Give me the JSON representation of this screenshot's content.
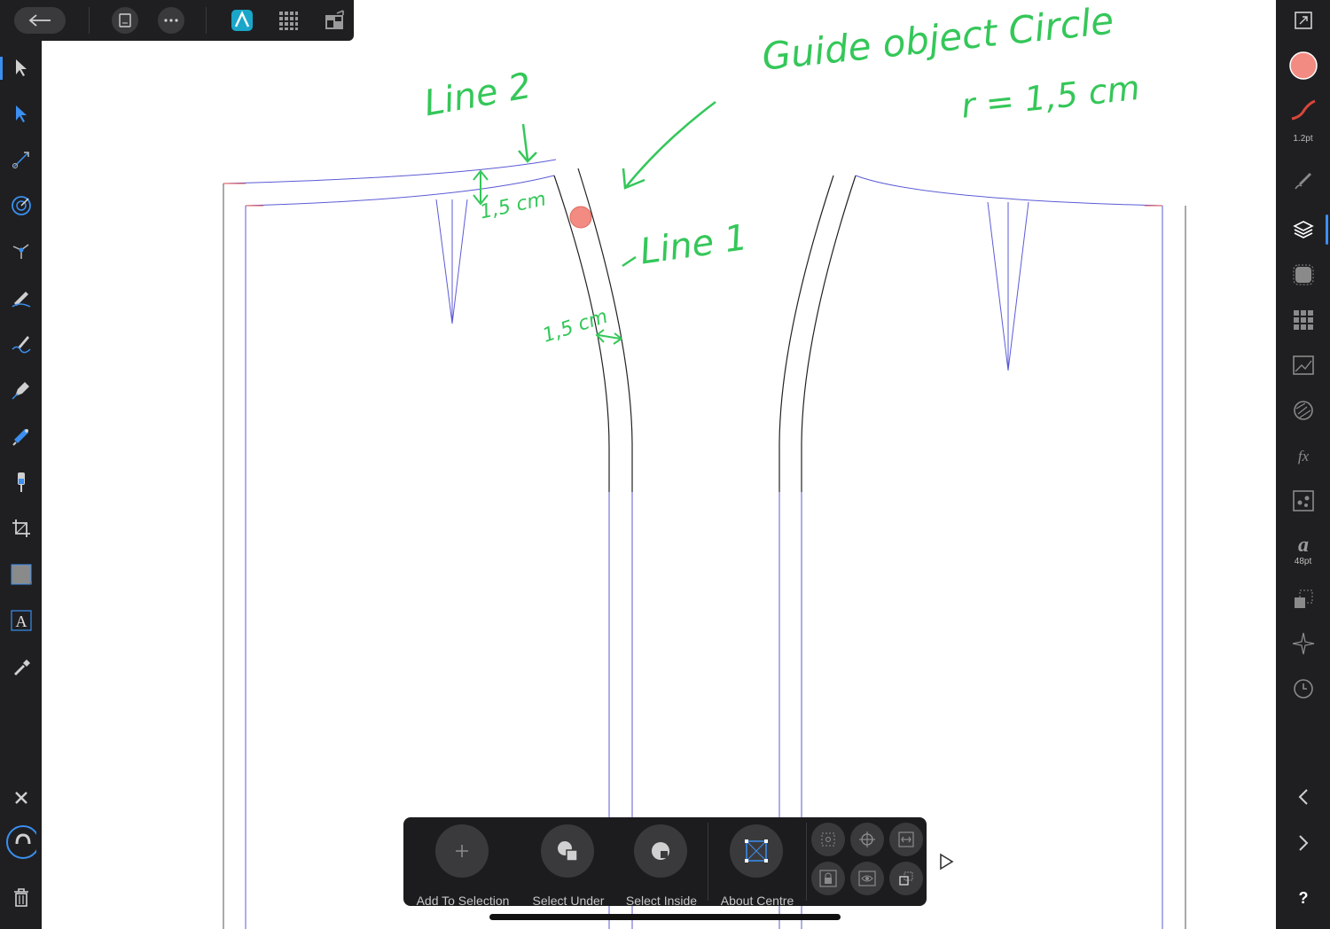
{
  "top_bar": {
    "back_icon": "arrow-left-icon",
    "document_icon": "document-icon",
    "more_icon": "ellipsis-icon",
    "persona_icon": "designer-persona-icon",
    "pixel_persona_icon": "pixel-grid-icon",
    "export_persona_icon": "export-persona-icon"
  },
  "left_tools": [
    "move-tool-icon",
    "node-tool-icon",
    "corner-tool-icon",
    "point-transform-icon",
    "contour-tool-icon",
    "pencil-tool-icon",
    "vector-brush-icon",
    "pen-tool-icon",
    "fill-tool-icon",
    "transparency-tool-icon",
    "crop-tool-icon",
    "rectangle-tool-icon",
    "artistic-text-icon",
    "color-picker-icon"
  ],
  "left_bottom": [
    "close-icon",
    "snapping-magnet-icon",
    "trash-icon"
  ],
  "right_studio": {
    "stroke_width": "1.2pt",
    "font_size": "48pt",
    "fill_color": "#f28b82",
    "stroke_color": "#d9463b"
  },
  "canvas_annotations": {
    "guide_title": "Guide object Circle",
    "guide_radius": "r = 1,5 cm",
    "line2": "Line 2",
    "line1": "Line 1",
    "measure_top": "1,5 cm",
    "measure_side": "1,5 cm"
  },
  "context_bar": {
    "items": [
      {
        "label": "Add To Selection",
        "icon": "plus-icon"
      },
      {
        "label": "Select Under",
        "icon": "select-under-icon"
      },
      {
        "label": "Select Inside",
        "icon": "select-inside-icon"
      },
      {
        "label": "About Centre",
        "icon": "about-centre-icon"
      }
    ],
    "small_icons": [
      "transform-origin-icon",
      "crosshair-icon",
      "align-icon",
      "lock-icon",
      "visibility-icon",
      "arrange-icon"
    ]
  },
  "colors": {
    "toolbar_bg": "#1f1f21",
    "accent_blue": "#3b8ff0",
    "annotation_green": "#34c759",
    "guide_circle": "#f28b82",
    "seam_blue": "#5b5bd6"
  }
}
